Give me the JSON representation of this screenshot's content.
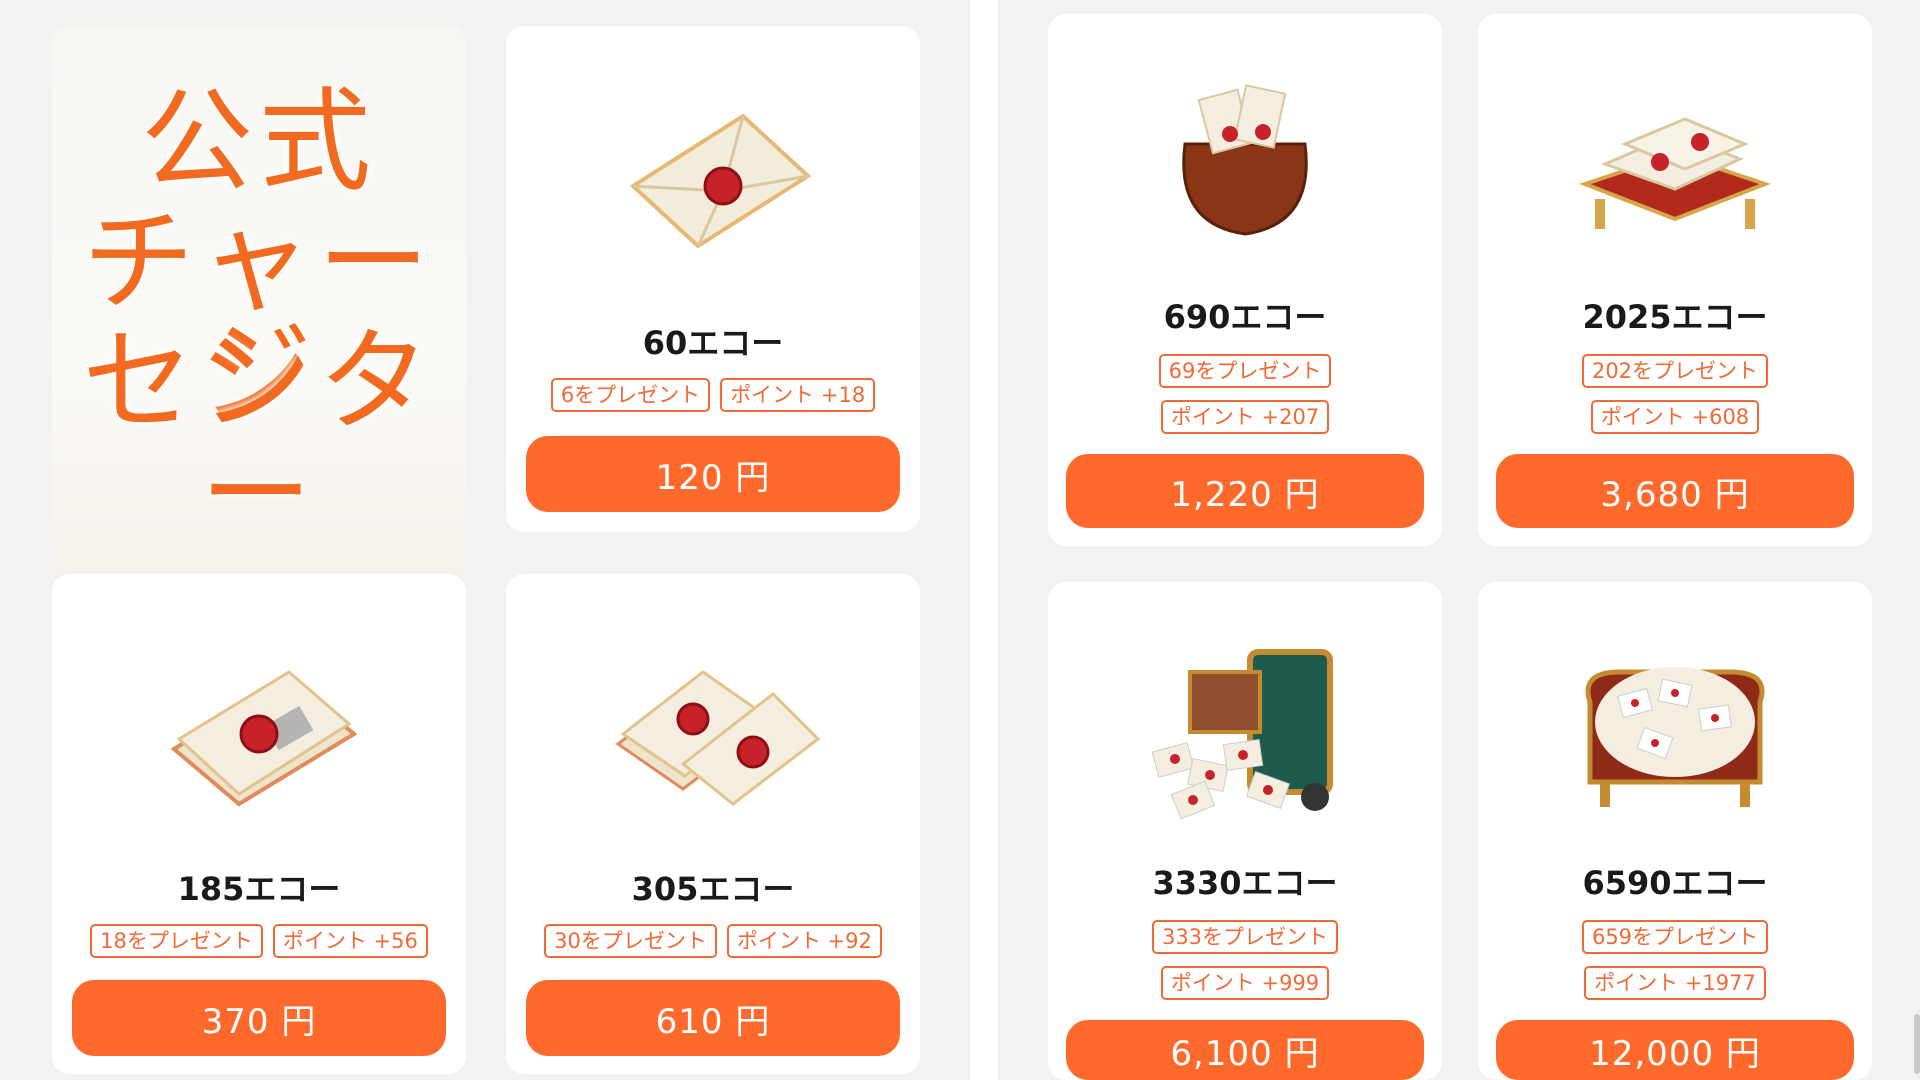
{
  "promo": {
    "lines": [
      "公式",
      "チャージ",
      "センター"
    ]
  },
  "left_items": [
    {
      "title": "60エコー",
      "gift": "6をプレゼント",
      "points": "ポイント +18",
      "price": "120 円",
      "icon": "sealed-envelope-icon"
    },
    {
      "title": "185エコー",
      "gift": "18をプレゼント",
      "points": "ポイント +56",
      "price": "370 円",
      "icon": "letter-bundle-icon"
    },
    {
      "title": "305エコー",
      "gift": "30をプレゼント",
      "points": "ポイント +92",
      "price": "610 円",
      "icon": "letter-stack-icon"
    }
  ],
  "right_items": [
    {
      "title": "690エコー",
      "gift": "69をプレゼント",
      "points": "ポイント +207",
      "price": "1,220 円",
      "icon": "letter-bag-icon"
    },
    {
      "title": "2025エコー",
      "gift": "202をプレゼント",
      "points": "ポイント +608",
      "price": "3,680 円",
      "icon": "letter-tray-icon"
    },
    {
      "title": "3330エコー",
      "gift": "333をプレゼント",
      "points": "ポイント +999",
      "price": "6,100 円",
      "icon": "letter-suitcase-icon"
    },
    {
      "title": "6590エコー",
      "gift": "659をプレゼント",
      "points": "ポイント +1977",
      "price": "12,000 円",
      "icon": "letter-armchair-icon"
    }
  ],
  "colors": {
    "accent": "#ff6a2c",
    "tag_border": "#f06a35",
    "card_bg": "#ffffff",
    "page_bg": "#f2f2f2"
  }
}
